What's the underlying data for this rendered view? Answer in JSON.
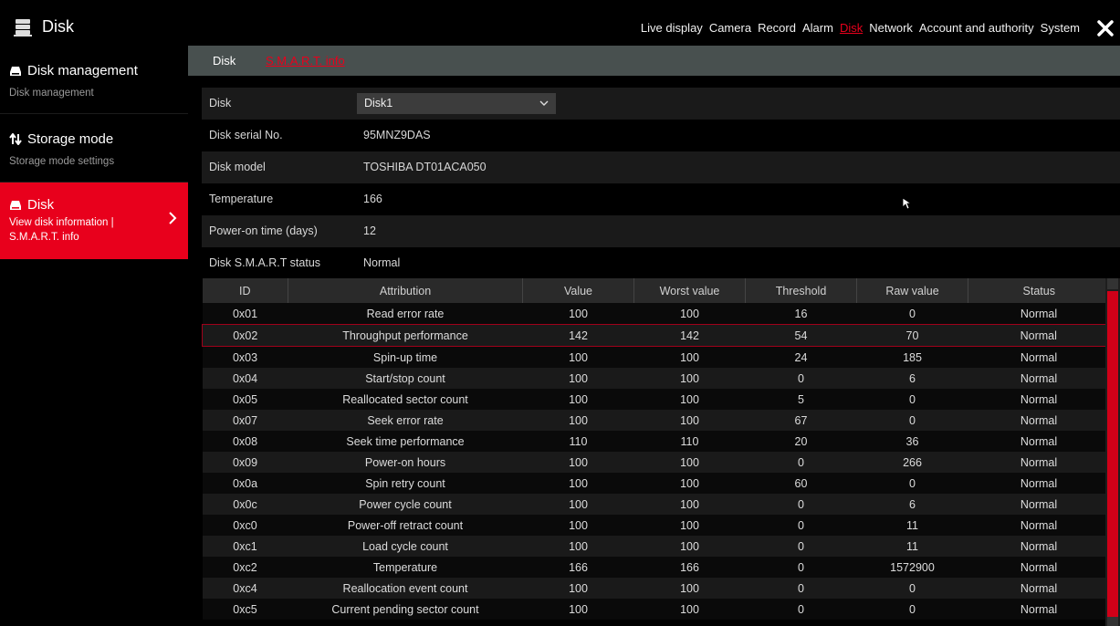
{
  "header": {
    "title": "Disk",
    "nav": [
      "Live display",
      "Camera",
      "Record",
      "Alarm",
      "Disk",
      "Network",
      "Account and authority",
      "System"
    ],
    "active_nav": "Disk"
  },
  "sidebar": {
    "items": [
      {
        "label": "Disk management",
        "sub": "Disk management",
        "icon": "disk-icon"
      },
      {
        "label": "Storage mode",
        "sub": "Storage mode settings",
        "icon": "sort-arrows-icon"
      },
      {
        "label": "Disk",
        "sub": "View disk information | S.M.A.R.T. info",
        "icon": "disk-icon",
        "active": true
      }
    ]
  },
  "tabs": [
    "Disk",
    "S.M.A.R.T. info"
  ],
  "info": {
    "disk_label": "Disk",
    "disk_value": "Disk1",
    "serial_label": "Disk serial No.",
    "serial_value": "95MNZ9DAS",
    "model_label": "Disk model",
    "model_value": "TOSHIBA DT01ACA050",
    "temp_label": "Temperature",
    "temp_value": "166",
    "power_label": "Power-on time (days)",
    "power_value": "12",
    "status_label": "Disk S.M.A.R.T status",
    "status_value": "Normal"
  },
  "table": {
    "columns": [
      "ID",
      "Attribution",
      "Value",
      "Worst value",
      "Threshold",
      "Raw value",
      "Status"
    ],
    "rows": [
      [
        "0x01",
        "Read error rate",
        "100",
        "100",
        "16",
        "0",
        "Normal"
      ],
      [
        "0x02",
        "Throughput performance",
        "142",
        "142",
        "54",
        "70",
        "Normal"
      ],
      [
        "0x03",
        "Spin-up time",
        "100",
        "100",
        "24",
        "185",
        "Normal"
      ],
      [
        "0x04",
        "Start/stop count",
        "100",
        "100",
        "0",
        "6",
        "Normal"
      ],
      [
        "0x05",
        "Reallocated sector count",
        "100",
        "100",
        "5",
        "0",
        "Normal"
      ],
      [
        "0x07",
        "Seek error rate",
        "100",
        "100",
        "67",
        "0",
        "Normal"
      ],
      [
        "0x08",
        "Seek time performance",
        "110",
        "110",
        "20",
        "36",
        "Normal"
      ],
      [
        "0x09",
        "Power-on hours",
        "100",
        "100",
        "0",
        "266",
        "Normal"
      ],
      [
        "0x0a",
        "Spin retry count",
        "100",
        "100",
        "60",
        "0",
        "Normal"
      ],
      [
        "0x0c",
        "Power cycle count",
        "100",
        "100",
        "0",
        "6",
        "Normal"
      ],
      [
        "0xc0",
        "Power-off retract count",
        "100",
        "100",
        "0",
        "11",
        "Normal"
      ],
      [
        "0xc1",
        "Load cycle count",
        "100",
        "100",
        "0",
        "11",
        "Normal"
      ],
      [
        "0xc2",
        "Temperature",
        "166",
        "166",
        "0",
        "1572900",
        "Normal"
      ],
      [
        "0xc4",
        "Reallocation event count",
        "100",
        "100",
        "0",
        "0",
        "Normal"
      ],
      [
        "0xc5",
        "Current pending sector count",
        "100",
        "100",
        "0",
        "0",
        "Normal"
      ]
    ],
    "selected_row": 1
  },
  "colors": {
    "accent": "#e8001c",
    "tabbar": "#48504f"
  }
}
